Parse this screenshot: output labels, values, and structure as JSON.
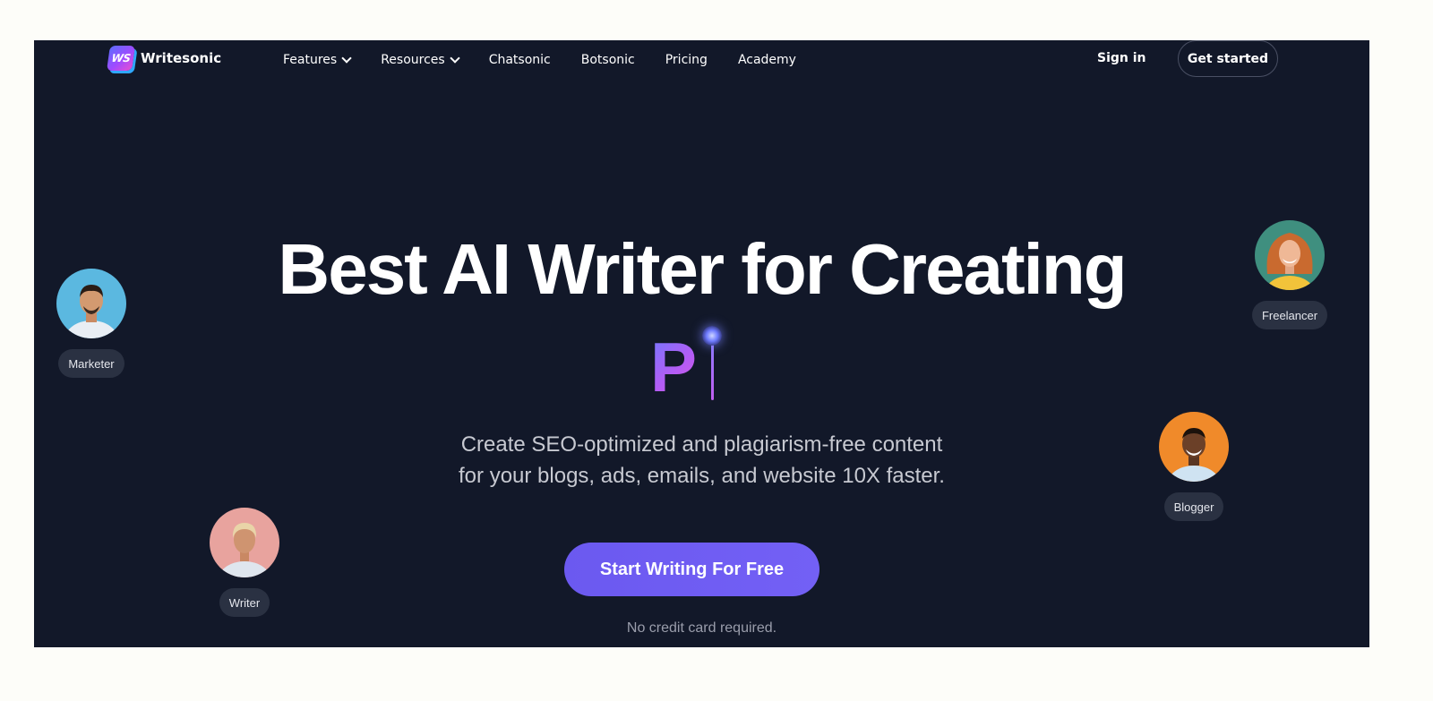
{
  "brand": {
    "logo_mark": "WS",
    "name": "Writesonic"
  },
  "nav": {
    "items": [
      {
        "label": "Features",
        "dropdown": true
      },
      {
        "label": "Resources",
        "dropdown": true
      },
      {
        "label": "Chatsonic",
        "dropdown": false
      },
      {
        "label": "Botsonic",
        "dropdown": false
      },
      {
        "label": "Pricing",
        "dropdown": false
      },
      {
        "label": "Academy",
        "dropdown": false
      }
    ],
    "sign_in": "Sign in",
    "get_started": "Get started"
  },
  "hero": {
    "title": "Best AI Writer for Creating",
    "typing_text": "P",
    "subtitle_line1": "Create SEO-optimized and plagiarism-free content",
    "subtitle_line2": "for your blogs, ads, emails, and website 10X faster.",
    "cta": "Start Writing For Free",
    "note": "No credit card required."
  },
  "personas": {
    "marketer": "Marketer",
    "writer": "Writer",
    "freelancer": "Freelancer",
    "blogger": "Blogger"
  },
  "colors": {
    "background": "#121829",
    "cta": "#6c5ce7",
    "tag_bg": "#2a3142",
    "accent_gradient": [
      "#6c7bff",
      "#b45cf5",
      "#e25ad8"
    ]
  }
}
